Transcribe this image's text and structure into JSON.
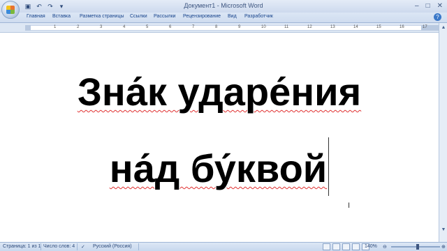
{
  "window": {
    "title": "Документ1 - Microsoft Word"
  },
  "quick_access": {
    "save_icon": "save-icon",
    "undo_icon": "undo-icon",
    "redo_icon": "redo-icon"
  },
  "ribbon": {
    "tabs": [
      "Главная",
      "Вставка",
      "Разметка страницы",
      "Ссылки",
      "Рассылки",
      "Рецензирование",
      "Вид",
      "Разработчик"
    ]
  },
  "document": {
    "line1": "Зна́к ударе́ния",
    "line2": "на́д бу́квой"
  },
  "status_bar": {
    "page": "Страница: 1 из 1",
    "words": "Число слов: 4",
    "language": "Русский (Россия)",
    "zoom": "140%"
  }
}
